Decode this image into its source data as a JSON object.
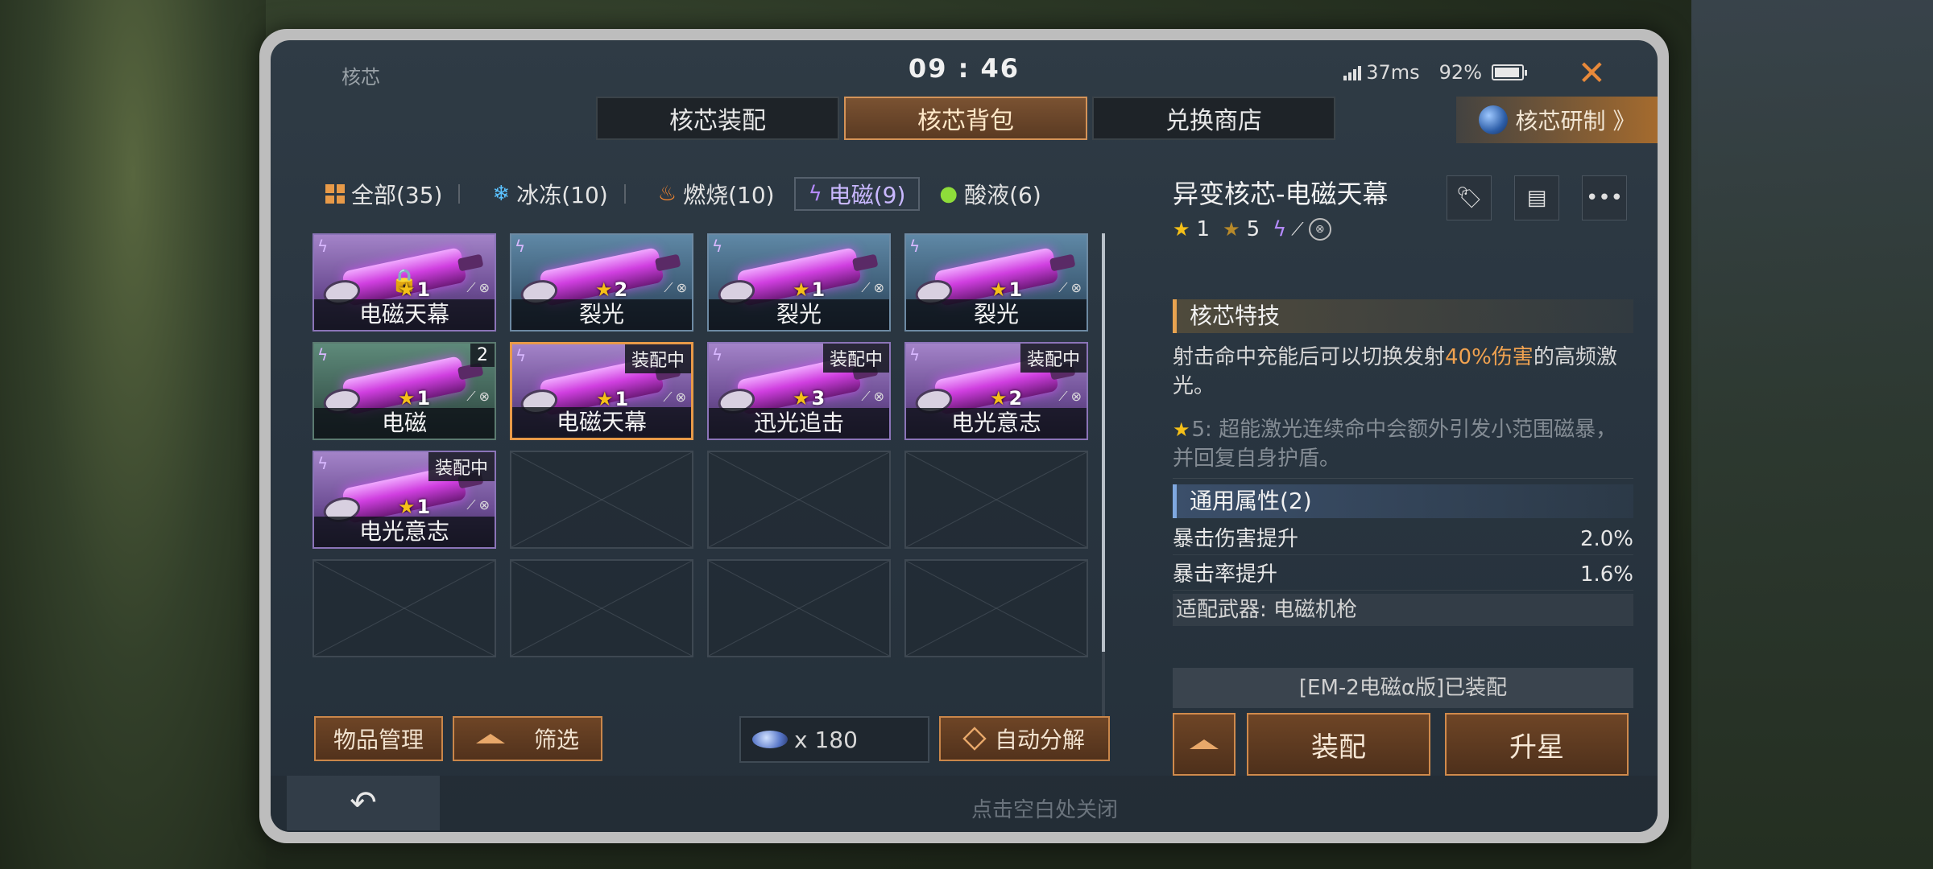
{
  "window": {
    "title": "核芯",
    "clock": "09 : 46",
    "ping": "37ms",
    "battery": "92%"
  },
  "tabs": [
    {
      "label": "核芯装配",
      "active": false
    },
    {
      "label": "核芯背包",
      "active": true
    },
    {
      "label": "兑换商店",
      "active": false
    }
  ],
  "research_button": {
    "label": "核芯研制 》"
  },
  "filters": [
    {
      "label": "全部(35)",
      "icon": "grid-icon",
      "active": false
    },
    {
      "label": "冰冻(10)",
      "icon": "snowflake-icon",
      "active": false
    },
    {
      "label": "燃烧(10)",
      "icon": "flame-icon",
      "active": false
    },
    {
      "label": "电磁(9)",
      "icon": "lightning-icon",
      "active": true
    },
    {
      "label": "酸液(6)",
      "icon": "acid-drop-icon",
      "active": false
    }
  ],
  "items": [
    {
      "name": "电磁天幕",
      "stars": "1",
      "style": "purple",
      "locked": true,
      "tag": "",
      "count": ""
    },
    {
      "name": "裂光",
      "stars": "2",
      "style": "blue",
      "locked": false,
      "tag": "",
      "count": ""
    },
    {
      "name": "裂光",
      "stars": "1",
      "style": "blue",
      "locked": false,
      "tag": "",
      "count": ""
    },
    {
      "name": "裂光",
      "stars": "1",
      "style": "blue",
      "locked": false,
      "tag": "",
      "count": ""
    },
    {
      "name": "电磁",
      "stars": "1",
      "style": "green",
      "locked": false,
      "tag": "",
      "count": "2"
    },
    {
      "name": "电磁天幕",
      "stars": "1",
      "style": "purple",
      "locked": false,
      "tag": "装配中",
      "count": "",
      "selected": true
    },
    {
      "name": "迅光追击",
      "stars": "3",
      "style": "purple",
      "locked": false,
      "tag": "装配中",
      "count": ""
    },
    {
      "name": "电光意志",
      "stars": "2",
      "style": "purple",
      "locked": false,
      "tag": "装配中",
      "count": ""
    },
    {
      "name": "电光意志",
      "stars": "1",
      "style": "purple",
      "locked": false,
      "tag": "装配中",
      "count": ""
    }
  ],
  "empty_slots": 7,
  "bottom": {
    "manage_label": "物品管理",
    "filter_label": "筛选",
    "currency_amount": "x 180",
    "auto_decompose_label": "自动分解"
  },
  "footer": {
    "hint": "点击空白处关闭",
    "back_icon": "↶"
  },
  "detail": {
    "title": "异变核芯-电磁天幕",
    "star_current": "1",
    "star_max": "5",
    "skill_header": "核芯特技",
    "skill_desc_pre": "射击命中充能后可以切换发射",
    "skill_desc_hl": "40%伤害",
    "skill_desc_post": "的高频激光。",
    "star5_desc": "5: 超能激光连续命中会额外引发小范围磁暴，并回复自身护盾。",
    "attr_header": "通用属性(2)",
    "attrs": [
      {
        "label": "暴击伤害提升",
        "value": "2.0%"
      },
      {
        "label": "暴击率提升",
        "value": "1.6%"
      }
    ],
    "weapon_fit": "适配武器: 电磁机枪",
    "equipped_text": "[EM-2电磁α版]已装配",
    "equip_label": "装配",
    "upgrade_label": "升星"
  },
  "colors": {
    "accent": "#e89a48",
    "panel": "#293540",
    "lightning": "#b58aff"
  }
}
